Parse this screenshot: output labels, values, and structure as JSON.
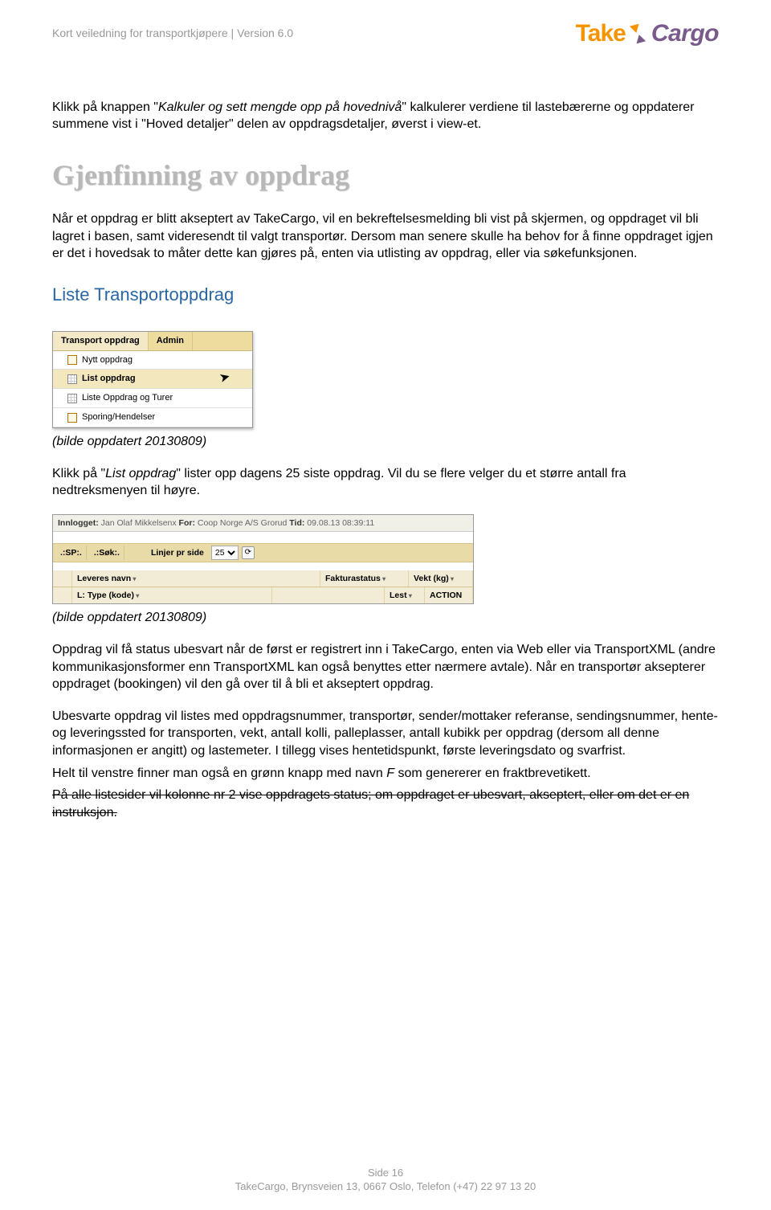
{
  "header": {
    "doc_title": "Kort veiledning for transportkjøpere | Version 6.0",
    "logo_take": "Take",
    "logo_cargo": "Cargo"
  },
  "paragraphs": {
    "p1_a": "Klikk på knappen \"",
    "p1_b": "Kalkuler og sett mengde opp på hovednivå",
    "p1_c": "\" kalkulerer verdiene til lastebærerne og oppdaterer summene vist i \"Hoved detaljer\" delen av oppdragsdetaljer, øverst i view-et."
  },
  "heading_gjenfinning": "Gjenfinning av oppdrag",
  "gjenfinning_para": "Når et oppdrag er blitt akseptert av TakeCargo, vil en bekreftelsesmelding bli vist på skjermen, og oppdraget vil bli lagret i basen, samt videresendt til valgt transportør. Dersom man senere skulle ha behov for å finne oppdraget igjen er det i hovedsak to måter dette kan gjøres på, enten via utlisting av oppdrag, eller via søkefunksjonen.",
  "heading_liste": "Liste Transportoppdrag",
  "menu_shot": {
    "tab_transport": "Transport oppdrag",
    "tab_admin": "Admin",
    "items": [
      "Nytt oppdrag",
      "List oppdrag",
      "Liste Oppdrag og Turer",
      "Sporing/Hendelser"
    ]
  },
  "caption1": "(bilde oppdatert 20130809)",
  "para_list_a": "Klikk på \"",
  "para_list_b": "List oppdrag",
  "para_list_c": "\" lister opp dagens 25 siste oppdrag. Vil du se flere velger du et større antall fra nedtreksmenyen til høyre.",
  "toolbar_shot": {
    "innlogget_label": "Innlogget:",
    "innlogget_user": "Jan Olaf Mikkelsenx",
    "for_label": "For:",
    "for_value": "Coop Norge A/S Grorud",
    "tid_label": "Tid:",
    "tid_value": "09.08.13 08:39:11",
    "filter_sp": ".:SP:.",
    "filter_sok": ".:Søk:.",
    "linjer_label": "Linjer pr side",
    "linjer_value": "25",
    "col_leveres": "Leveres navn",
    "col_faktura": "Fakturastatus",
    "col_vekt": "Vekt (kg)",
    "col_ltype": "L: Type (kode)",
    "col_lest": "Lest",
    "col_action": "ACTION"
  },
  "caption2": "(bilde oppdatert 20130809)",
  "para_status": "Oppdrag vil få status ubesvart når de først er registrert inn i TakeCargo, enten via Web eller via TransportXML (andre kommunikasjonsformer enn TransportXML kan også benyttes etter nærmere avtale). Når en transportør aksepterer oppdraget (bookingen) vil den gå over til å bli et akseptert oppdrag.",
  "para_ubesvarte": "Ubesvarte oppdrag vil listes med oppdragsnummer, transportør, sender/mottaker referanse, sendingsnummer, hente- og leveringssted for transporten, vekt, antall kolli, palleplasser, antall kubikk per oppdrag (dersom all denne informasjonen er angitt) og lastemeter. I tillegg vises hentetidspunkt, første leveringsdato og svarfrist.",
  "para_venstre_a": "Helt til venstre finner man også en grønn knapp med navn ",
  "para_venstre_b": "F",
  "para_venstre_c": " som genererer en fraktbrevetikett.",
  "para_strike": "På alle listesider vil kolonne nr 2 vise oppdragets status; om oppdraget er ubesvart, akseptert, eller om det er en instruksjon.",
  "footer": {
    "page": "Side 16",
    "contact": "TakeCargo, Brynsveien 13, 0667 Oslo, Telefon (+47)  22 97 13 20"
  }
}
